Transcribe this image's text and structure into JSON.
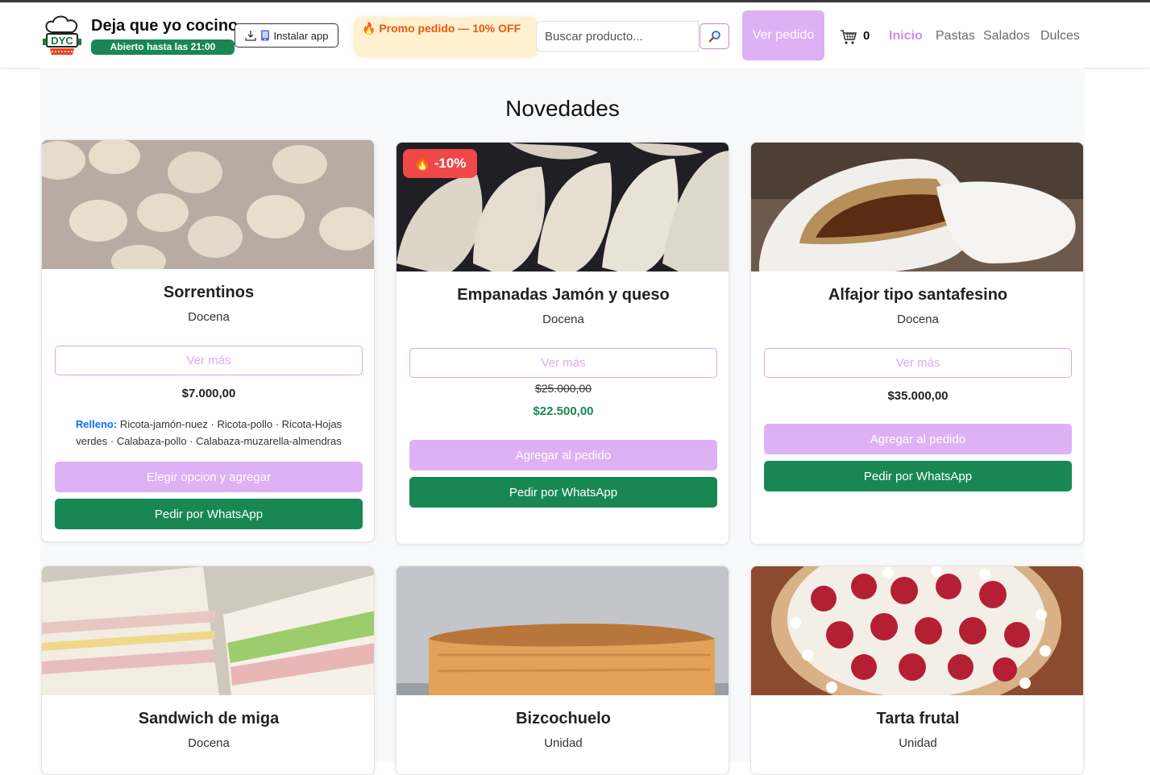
{
  "header": {
    "logo_text": "DYC",
    "brand_name": "Deja que yo cocino",
    "open_badge": "Abierto hasta las 21:00",
    "install_label": "Instalar app",
    "promo_text": "Promo pedido — 10% OFF",
    "search_placeholder": "Buscar producto...",
    "ver_pedido_label": "Ver pedido",
    "cart_count": "0",
    "nav": [
      "Inicio",
      "Pastas",
      "Salados",
      "Dulces"
    ],
    "active_nav": "Inicio"
  },
  "main": {
    "section_title": "Novedades",
    "ver_mas_label": "Ver más",
    "add_label": "Agregar al pedido",
    "choose_label": "Elegir opcion y agregar",
    "whatsapp_label": "Pedir por WhatsApp",
    "products": [
      {
        "name": "Sorrentinos",
        "unit": "Docena",
        "price": "$7.000,00",
        "relleno_label": "Relleno:",
        "relleno_text": "Ricota-jamón-nuez · Ricota-pollo · Ricota-Hojas verdes · Calabaza-pollo · Calabaza-muzarella-almendras"
      },
      {
        "name": "Empanadas Jamón y queso",
        "unit": "Docena",
        "badge": "-10%",
        "old_price": "$25.000,00",
        "new_price": "$22.500,00"
      },
      {
        "name": "Alfajor tipo santafesino",
        "unit": "Docena",
        "price": "$35.000,00"
      },
      {
        "name": "Sandwich de miga",
        "unit": "Docena"
      },
      {
        "name": "Bizcochuelo",
        "unit": "Unidad"
      },
      {
        "name": "Tarta frutal",
        "unit": "Unidad"
      }
    ]
  },
  "colors": {
    "accent_lilac": "#ddb1f4",
    "whatsapp_green": "#198754",
    "discount_red": "#f04848",
    "promo_orange": "#e8590c"
  }
}
